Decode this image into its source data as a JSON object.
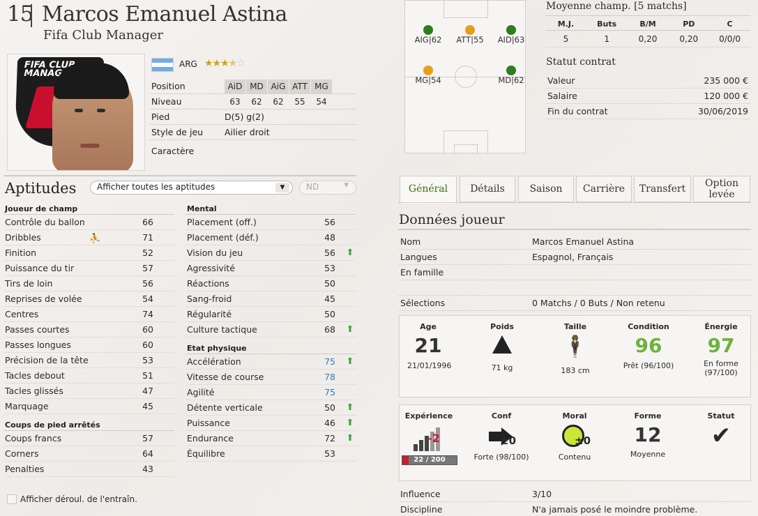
{
  "header": {
    "number": "15",
    "name": "Marcos Emanuel Astina",
    "club": "Fifa Club Manager"
  },
  "photo": {
    "logo_text": "FIFA CLUB MANAGER"
  },
  "identity": {
    "nationality": "ARG",
    "stars": 3.5
  },
  "positions": {
    "label": "Position",
    "codes": [
      "AiD",
      "MD",
      "AiG",
      "ATT",
      "MG"
    ]
  },
  "level": {
    "label": "Niveau",
    "values": [
      "63",
      "62",
      "62",
      "55",
      "54"
    ]
  },
  "foot": {
    "label": "Pied",
    "value": "D(5) g(2)"
  },
  "style": {
    "label": "Style de jeu",
    "value": "Ailier droit"
  },
  "character": {
    "label": "Caractère",
    "value": ""
  },
  "aptitudes": {
    "title": "Aptitudes",
    "filter": "Afficher toutes les aptitudes",
    "filter2": "ND",
    "field_player": {
      "title": "Joueur de champ",
      "items": [
        {
          "label": "Contrôle du ballon",
          "value": "66"
        },
        {
          "label": "Dribbles",
          "value": "71"
        },
        {
          "label": "Finition",
          "value": "52"
        },
        {
          "label": "Puissance du tir",
          "value": "57"
        },
        {
          "label": "Tirs de loin",
          "value": "56"
        },
        {
          "label": "Reprises de volée",
          "value": "54"
        },
        {
          "label": "Centres",
          "value": "74"
        },
        {
          "label": "Passes courtes",
          "value": "60"
        },
        {
          "label": "Passes longues",
          "value": "60"
        },
        {
          "label": "Précision de la tête",
          "value": "53"
        },
        {
          "label": "Tacles debout",
          "value": "51"
        },
        {
          "label": "Tacles glissés",
          "value": "47"
        },
        {
          "label": "Marquage",
          "value": "45"
        }
      ]
    },
    "set_pieces": {
      "title": "Coups de pied arrêtés",
      "items": [
        {
          "label": "Coups francs",
          "value": "57"
        },
        {
          "label": "Corners",
          "value": "64"
        },
        {
          "label": "Penalties",
          "value": "43"
        }
      ]
    },
    "mental": {
      "title": "Mental",
      "items": [
        {
          "label": "Placement (off.)",
          "value": "56"
        },
        {
          "label": "Placement (déf.)",
          "value": "48"
        },
        {
          "label": "Vision du jeu",
          "value": "56"
        },
        {
          "label": "Agressivité",
          "value": "53"
        },
        {
          "label": "Réactions",
          "value": "50"
        },
        {
          "label": "Sang-froid",
          "value": "45"
        },
        {
          "label": "Régularité",
          "value": "50"
        },
        {
          "label": "Culture tactique",
          "value": "68"
        }
      ]
    },
    "physical": {
      "title": "Etat physique",
      "items": [
        {
          "label": "Accélération",
          "value": "75"
        },
        {
          "label": "Vitesse de course",
          "value": "78"
        },
        {
          "label": "Agilité",
          "value": "75"
        },
        {
          "label": "Détente verticale",
          "value": "50"
        },
        {
          "label": "Puissance",
          "value": "46"
        },
        {
          "label": "Endurance",
          "value": "72"
        },
        {
          "label": "Équilibre",
          "value": "53"
        }
      ]
    },
    "training_checkbox": "Afficher déroul. de l'entraîn."
  },
  "pitch": {
    "players": [
      {
        "tag": "AIG|62",
        "color": "#2e7d1e"
      },
      {
        "tag": "ATT|55",
        "color": "#e3a01a"
      },
      {
        "tag": "AID|63",
        "color": "#2e7d1e"
      },
      {
        "tag": "MG|54",
        "color": "#e3a01a"
      },
      {
        "tag": "MD|62",
        "color": "#2e7d1e"
      }
    ]
  },
  "season_avg": {
    "title": "Moyenne champ. [5 matchs]",
    "headers": [
      "M.J.",
      "Buts",
      "B/M",
      "PD",
      "C"
    ],
    "values": [
      "5",
      "1",
      "0,20",
      "0,20",
      "0/0/0"
    ]
  },
  "contract": {
    "title": "Statut contrat",
    "rows": [
      {
        "label": "Valeur",
        "value": "235 000 €"
      },
      {
        "label": "Salaire",
        "value": "120 000 €"
      },
      {
        "label": "Fin du contrat",
        "value": "30/06/2019"
      }
    ]
  },
  "tabs": [
    "Général",
    "Détails",
    "Saison",
    "Carrière",
    "Transfert",
    "Option levée"
  ],
  "player_data": {
    "title": "Données joueur",
    "rows": [
      {
        "label": "Nom",
        "value": "Marcos Emanuel Astina"
      },
      {
        "label": "Langues",
        "value": "Espagnol, Français"
      },
      {
        "label": "En famille",
        "value": ""
      },
      {
        "label": "",
        "value": ""
      },
      {
        "label": "Sélections",
        "value": "0 Matchs / 0 Buts / Non retenu"
      }
    ]
  },
  "stats1": {
    "age": {
      "label": "Age",
      "value": "21",
      "sub": "21/01/1996"
    },
    "weight": {
      "label": "Poids",
      "sub": "71 kg"
    },
    "height": {
      "label": "Taille",
      "sub": "183 cm"
    },
    "condition": {
      "label": "Condition",
      "value": "96",
      "sub": "Prêt (96/100)"
    },
    "energy": {
      "label": "Énergie",
      "value": "97",
      "sub": "En forme (97/100)"
    }
  },
  "stats2": {
    "experience": {
      "label": "Expérience",
      "delta": "-2",
      "progress": "22 / 200",
      "fraction": 0.11
    },
    "confidence": {
      "label": "Conf",
      "delta": "±0",
      "sub": "Forte (98/100)"
    },
    "morale": {
      "label": "Moral",
      "delta": "±0",
      "sub": "Contenu"
    },
    "form": {
      "label": "Forme",
      "value": "12",
      "sub": "Moyenne"
    },
    "status": {
      "label": "Statut"
    }
  },
  "influence": {
    "label": "Influence",
    "value": "3/10"
  },
  "discipline": {
    "label": "Discipline",
    "value": "N'a jamais posé le moindre problème."
  },
  "colors": {
    "green": "#6db33a",
    "blue": "#2a7cc2",
    "active_tab": "#3e6a1a"
  }
}
